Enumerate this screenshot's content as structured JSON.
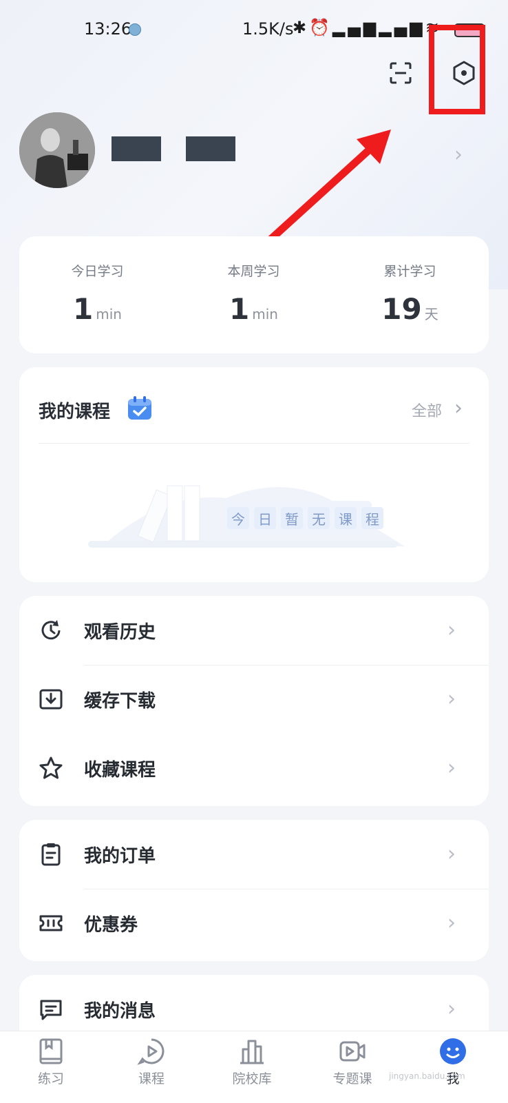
{
  "status_bar": {
    "time": "13:26",
    "network_speed": "1.5K/s",
    "icons": [
      "bluetooth-icon",
      "alarm-icon",
      "signal-hd-icon",
      "signal-hd-icon",
      "wifi-icon",
      "battery-icon"
    ]
  },
  "header": {
    "scan_icon": "scan-icon",
    "settings_icon": "settings-hexagon-icon"
  },
  "annotation": {
    "highlight_color": "#ee1c1c"
  },
  "profile": {
    "name_redacted": true
  },
  "stats": [
    {
      "label": "今日学习",
      "value": "1",
      "unit": "min"
    },
    {
      "label": "本周学习",
      "value": "1",
      "unit": "min"
    },
    {
      "label": "累计学习",
      "value": "19",
      "unit": "天"
    }
  ],
  "my_courses": {
    "title": "我的课程",
    "all_label": "全部",
    "empty_chars": [
      "今",
      "日",
      "暂",
      "无",
      "课",
      "程"
    ]
  },
  "menu_group1": [
    {
      "label": "观看历史",
      "icon": "history-clock-icon"
    },
    {
      "label": "缓存下载",
      "icon": "download-icon"
    },
    {
      "label": "收藏课程",
      "icon": "star-icon"
    }
  ],
  "menu_group2": [
    {
      "label": "我的订单",
      "icon": "clipboard-icon"
    },
    {
      "label": "优惠券",
      "icon": "coupon-icon"
    }
  ],
  "menu_group3": [
    {
      "label": "我的消息",
      "icon": "message-icon"
    }
  ],
  "tabs": [
    {
      "label": "练习",
      "icon": "book-icon",
      "active": false
    },
    {
      "label": "课程",
      "icon": "play-bubble-icon",
      "active": false
    },
    {
      "label": "院校库",
      "icon": "building-icon",
      "active": false
    },
    {
      "label": "专题课",
      "icon": "video-camera-icon",
      "active": false
    },
    {
      "label": "我",
      "icon": "profile-face-icon",
      "active": true
    }
  ],
  "colors": {
    "accent": "#2f6ee6",
    "background": "#f3f5f9",
    "card": "#ffffff"
  },
  "watermark": "jingyan.baidu.com"
}
